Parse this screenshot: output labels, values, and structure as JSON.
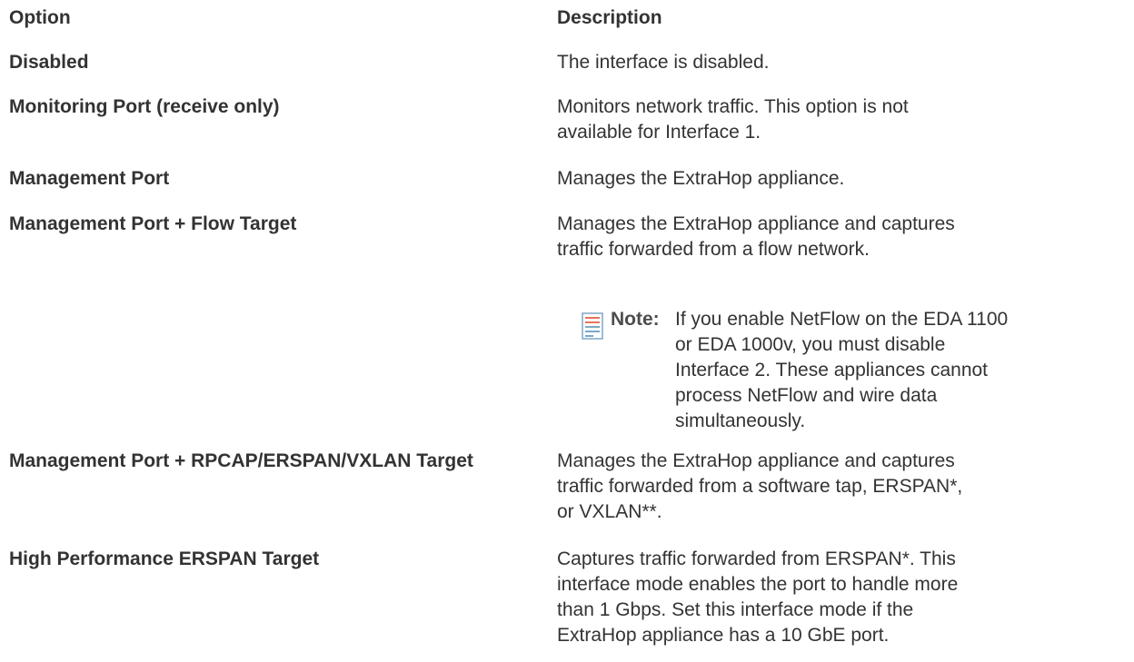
{
  "table": {
    "headers": {
      "option": "Option",
      "description": "Description"
    },
    "rows": [
      {
        "option": "Disabled",
        "description": "The interface is disabled."
      },
      {
        "option": "Monitoring Port (receive only)",
        "description": "Monitors network traffic. This option is not available for Interface 1."
      },
      {
        "option": "Management Port",
        "description": "Manages the ExtraHop appliance."
      },
      {
        "option": "Management Port + Flow Target",
        "description": "Manages the ExtraHop appliance and captures traffic forwarded from a flow network."
      },
      {
        "option": "Management Port + RPCAP/ERSPAN/VXLAN Target",
        "description": "Manages the ExtraHop appliance and captures traffic forwarded from a software tap, ERSPAN*, or VXLAN**."
      },
      {
        "option": "High Performance ERSPAN Target",
        "description": "Captures traffic forwarded from ERSPAN*. This interface mode enables the port to handle more than 1 Gbps. Set this interface mode if the ExtraHop appliance has a 10 GbE port."
      }
    ],
    "note": {
      "label": "Note:",
      "text": "If you enable NetFlow on the EDA 1100 or EDA 1000v, you must disable Interface 2. These appliances cannot process NetFlow and wire data simultaneously.",
      "icon": "note-icon",
      "icon_color": "#e8745a",
      "icon_lines_color": "#7da7c9"
    }
  }
}
